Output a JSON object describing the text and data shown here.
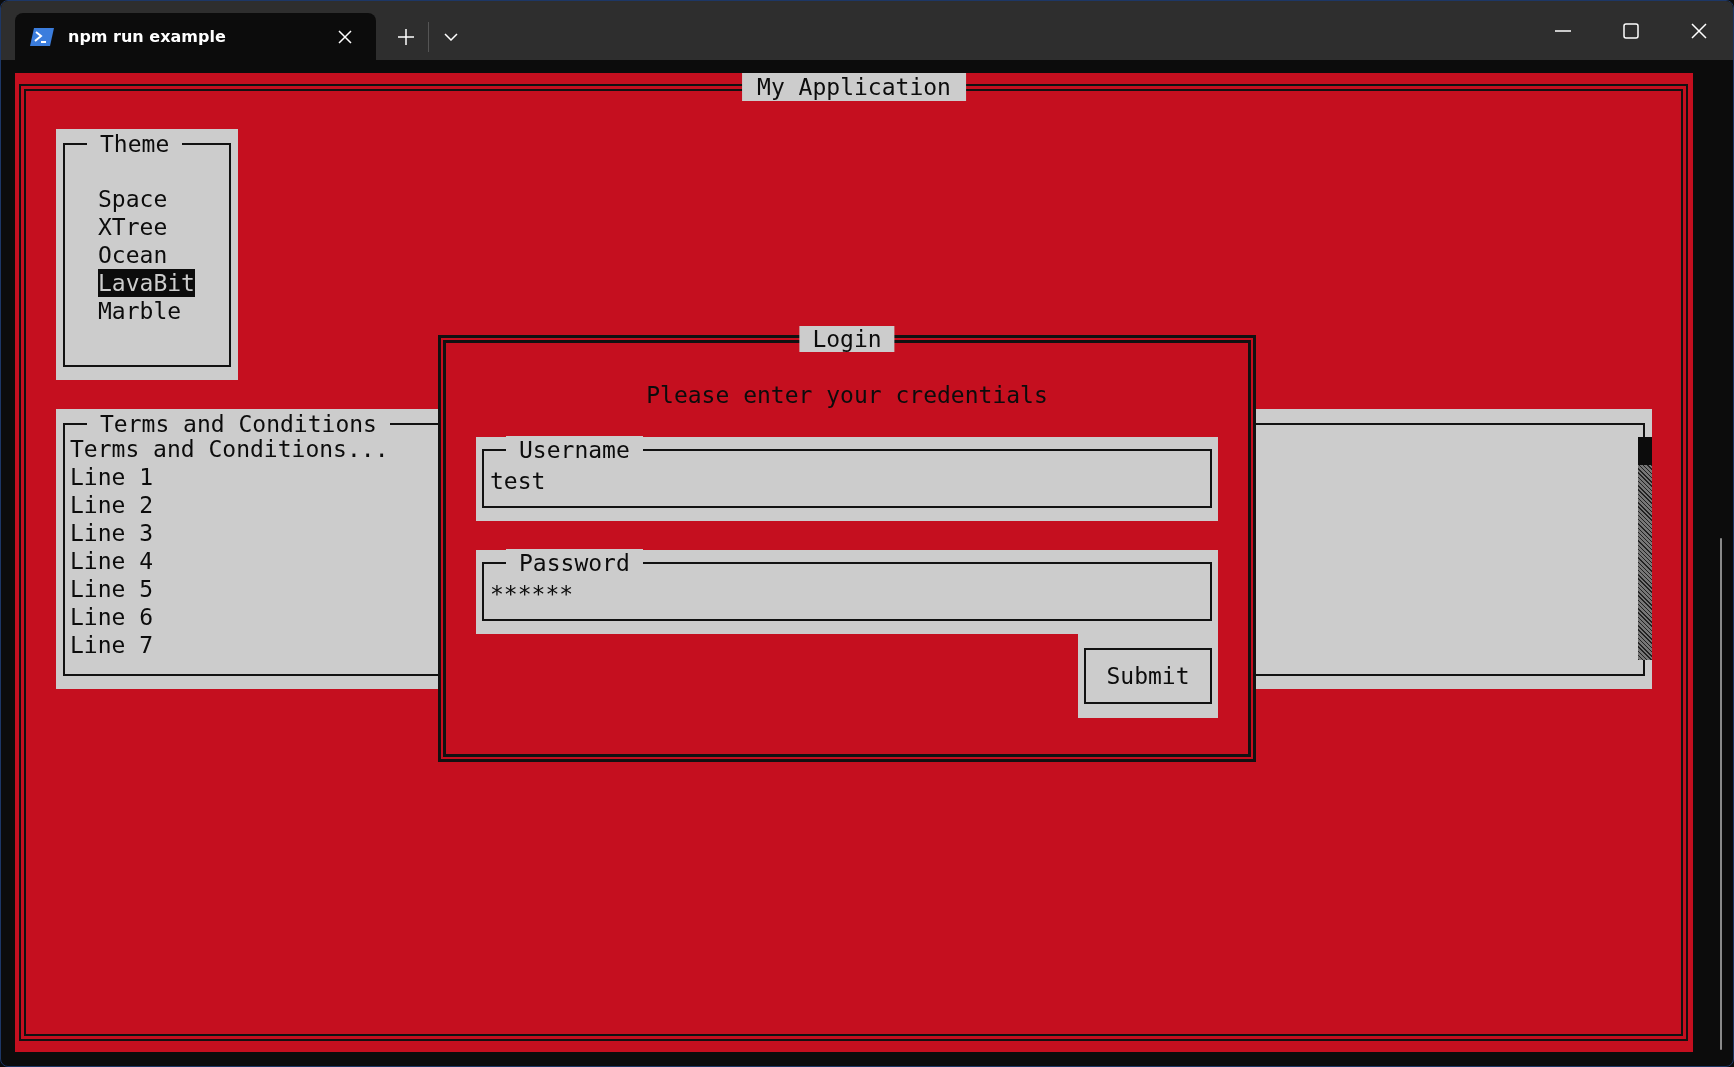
{
  "window": {
    "tab_title": "npm run example"
  },
  "app": {
    "title": "My Application",
    "theme_panel": {
      "title": "Theme",
      "items": [
        {
          "label": "Space",
          "selected": false
        },
        {
          "label": "XTree",
          "selected": false
        },
        {
          "label": "Ocean",
          "selected": false
        },
        {
          "label": "LavaBit",
          "selected": true
        },
        {
          "label": "Marble",
          "selected": false
        }
      ]
    },
    "terms_panel": {
      "title": "Terms and Conditions",
      "lines": [
        "Terms and Conditions...",
        "Line 1",
        "Line 2",
        "Line 3",
        "Line 4",
        "Line 5",
        "Line 6",
        "Line 7"
      ]
    },
    "login_dialog": {
      "title": "Login",
      "prompt": "Please enter your credentials",
      "fields": [
        {
          "label": "Username",
          "value": "test"
        },
        {
          "label": "Password",
          "value": "******"
        }
      ],
      "submit": "Submit"
    }
  }
}
